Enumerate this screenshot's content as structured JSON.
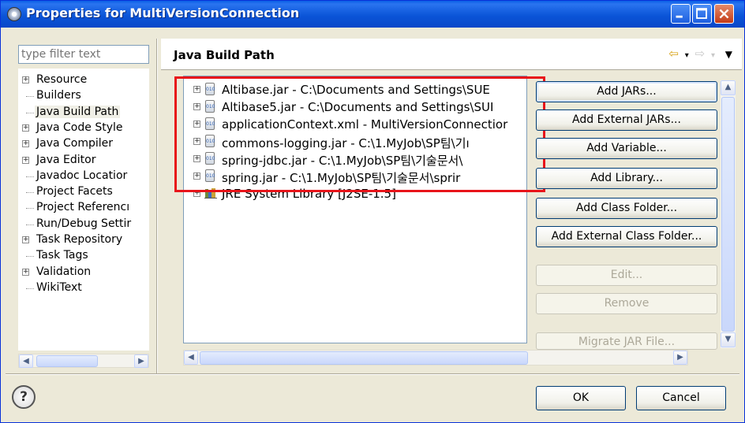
{
  "window": {
    "title": "Properties for MultiVersionConnection",
    "icon": "gear-icon"
  },
  "filter": {
    "placeholder": "type filter text"
  },
  "left_tree": {
    "items": [
      {
        "label": "Resource",
        "expandable": true
      },
      {
        "label": "Builders",
        "expandable": false
      },
      {
        "label": "Java Build Path",
        "expandable": false,
        "selected": true
      },
      {
        "label": "Java Code Style",
        "expandable": true
      },
      {
        "label": "Java Compiler",
        "expandable": true
      },
      {
        "label": "Java Editor",
        "expandable": true
      },
      {
        "label": "Javadoc Locatior",
        "expandable": false
      },
      {
        "label": "Project Facets",
        "expandable": false
      },
      {
        "label": "Project Referencı",
        "expandable": false
      },
      {
        "label": "Run/Debug Settir",
        "expandable": false
      },
      {
        "label": "Task Repository",
        "expandable": true
      },
      {
        "label": "Task Tags",
        "expandable": false
      },
      {
        "label": "Validation",
        "expandable": true
      },
      {
        "label": "WikiText",
        "expandable": false
      }
    ]
  },
  "page": {
    "title": "Java Build Path"
  },
  "libraries": {
    "items": [
      {
        "label": "Altibase.jar - C:\\Documents and Settings\\SUE",
        "icon": "jar-icon"
      },
      {
        "label": "Altibase5.jar - C:\\Documents and Settings\\SUI",
        "icon": "jar-icon"
      },
      {
        "label": "applicationContext.xml - MultiVersionConnectior",
        "icon": "jar-icon"
      },
      {
        "label": "commons-logging.jar - C:\\1.MyJob\\SP팀\\기ı",
        "icon": "jar-icon"
      },
      {
        "label": "spring-jdbc.jar - C:\\1.MyJob\\SP팀\\기술문서\\",
        "icon": "jar-icon"
      },
      {
        "label": "spring.jar - C:\\1.MyJob\\SP팀\\기술문서\\sprir",
        "icon": "jar-icon"
      },
      {
        "label": "JRE System Library [J2SE-1.5]",
        "icon": "library-icon"
      }
    ]
  },
  "buttons": {
    "add_jars": "Add JARs...",
    "add_external_jars": "Add External JARs...",
    "add_variable": "Add Variable...",
    "add_library": "Add Library...",
    "add_class_folder": "Add Class Folder...",
    "add_external_class_folder": "Add External Class Folder...",
    "edit": "Edit...",
    "remove": "Remove",
    "migrate": "Migrate JAR File..."
  },
  "footer": {
    "ok": "OK",
    "cancel": "Cancel",
    "help": "?"
  },
  "colors": {
    "highlight": "#e8141a",
    "titlebar": "#0b55d8"
  }
}
